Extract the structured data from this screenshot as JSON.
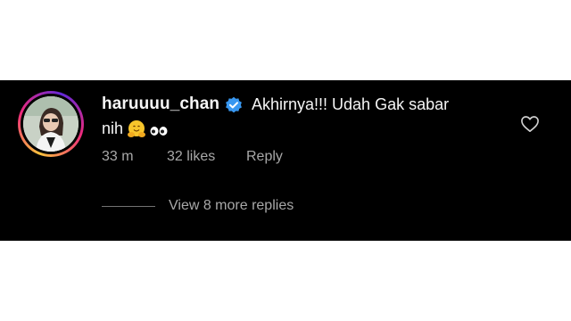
{
  "comment": {
    "username": "haruuuu_chan",
    "verified": true,
    "text_line1": "Akhirnya!!! Udah Gak sabar",
    "text_line2": "nih",
    "emojis": [
      "hugging-face",
      "eyes"
    ],
    "time_ago": "33 m",
    "likes": "32 likes",
    "reply_label": "Reply",
    "view_replies_label": "View 8 more replies"
  },
  "colors": {
    "background": "#000000",
    "text_primary": "#f5f5f5",
    "text_secondary": "#a8a8a8",
    "verified_badge": "#3897f0"
  },
  "icons": {
    "verified": "verified-badge-icon",
    "like": "heart-outline-icon"
  }
}
